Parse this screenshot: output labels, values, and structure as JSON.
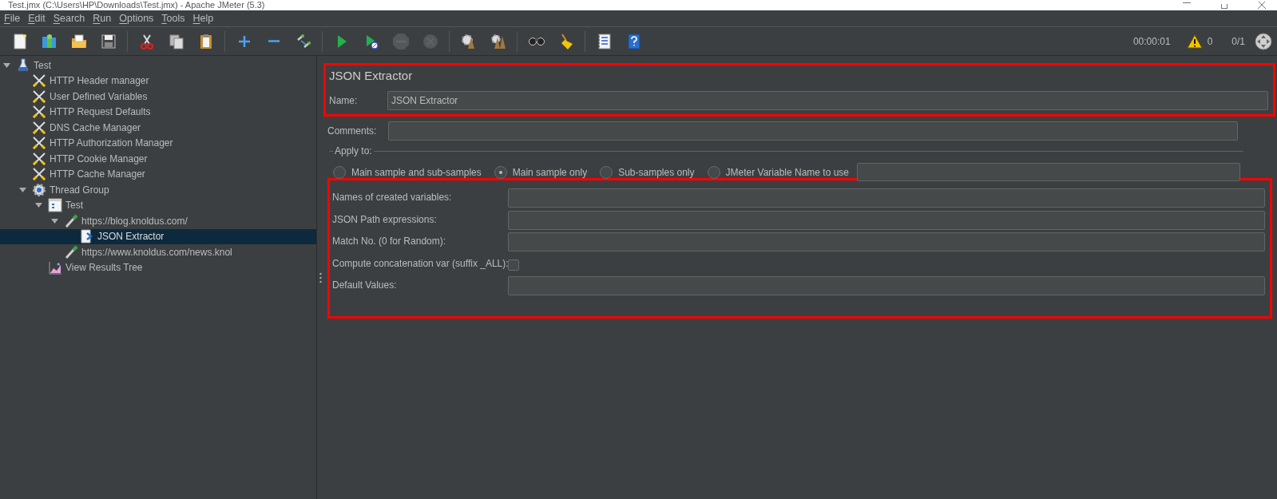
{
  "window": {
    "title": "Test.jmx (C:\\Users\\HP\\Downloads\\Test.jmx) - Apache JMeter (5.3)"
  },
  "menu": [
    "File",
    "Edit",
    "Search",
    "Run",
    "Options",
    "Tools",
    "Help"
  ],
  "toolbar": {
    "groups": [
      [
        {
          "kind": "new",
          "disabled": false
        },
        {
          "kind": "templates",
          "disabled": false
        },
        {
          "kind": "open",
          "disabled": false
        },
        {
          "kind": "save",
          "disabled": false
        }
      ],
      [
        {
          "kind": "cut",
          "disabled": false
        },
        {
          "kind": "copy",
          "disabled": false
        },
        {
          "kind": "paste",
          "disabled": false
        }
      ],
      [
        {
          "kind": "expand",
          "disabled": false
        },
        {
          "kind": "collapse",
          "disabled": false
        },
        {
          "kind": "toggle",
          "disabled": false
        }
      ],
      [
        {
          "kind": "start",
          "disabled": false
        },
        {
          "kind": "start-no-pauses",
          "disabled": false
        },
        {
          "kind": "stop",
          "disabled": true
        },
        {
          "kind": "shutdown",
          "disabled": true
        }
      ],
      [
        {
          "kind": "clear",
          "disabled": false
        },
        {
          "kind": "clear-all",
          "disabled": false
        }
      ],
      [
        {
          "kind": "search",
          "disabled": false
        },
        {
          "kind": "reset-search",
          "disabled": false
        }
      ],
      [
        {
          "kind": "functions",
          "disabled": false
        },
        {
          "kind": "help",
          "disabled": false
        }
      ]
    ],
    "timer": "00:00:01",
    "warnings": "0",
    "threads": "0/1"
  },
  "tree": [
    {
      "label": "Test",
      "kind": "test-plan",
      "expanded": true,
      "selected": false,
      "children": [
        {
          "label": "HTTP Header manager",
          "kind": "config",
          "selected": false
        },
        {
          "label": "User Defined Variables",
          "kind": "config",
          "selected": false
        },
        {
          "label": "HTTP Request Defaults",
          "kind": "config",
          "selected": false
        },
        {
          "label": "DNS Cache Manager",
          "kind": "config",
          "selected": false
        },
        {
          "label": "HTTP Authorization Manager",
          "kind": "config",
          "selected": false
        },
        {
          "label": "HTTP Cookie Manager",
          "kind": "config",
          "selected": false
        },
        {
          "label": "HTTP Cache Manager",
          "kind": "config",
          "selected": false
        },
        {
          "label": "Thread Group",
          "kind": "thread-group",
          "expanded": true,
          "selected": false,
          "children": [
            {
              "label": "Test",
              "kind": "controller",
              "expanded": true,
              "selected": false,
              "children": [
                {
                  "label": "https://blog.knoldus.com/",
                  "kind": "sampler",
                  "expanded": true,
                  "selected": false,
                  "children": [
                    {
                      "label": "JSON Extractor",
                      "kind": "extractor",
                      "selected": true
                    }
                  ]
                },
                {
                  "label": "https://www.knoldus.com/news.knol",
                  "kind": "sampler",
                  "selected": false
                }
              ]
            },
            {
              "label": "View Results Tree",
              "kind": "listener",
              "selected": false
            }
          ]
        }
      ]
    }
  ],
  "editor": {
    "title": "JSON Extractor",
    "name_label": "Name:",
    "name_value": "JSON Extractor",
    "comments_label": "Comments:",
    "apply_to": {
      "label": "Apply to:",
      "options": [
        {
          "label": "Main sample and sub-samples",
          "selected": false
        },
        {
          "label": "Main sample only",
          "selected": true
        },
        {
          "label": "Sub-samples only",
          "selected": false
        },
        {
          "label": "JMeter Variable Name to use",
          "selected": false
        }
      ]
    },
    "header_highlighted": true,
    "fields_highlighted": true,
    "fields": [
      {
        "kind": "text",
        "label": "Names of created variables:"
      },
      {
        "kind": "text",
        "label": "JSON Path expressions:"
      },
      {
        "kind": "text",
        "label": "Match No. (0 for Random):"
      },
      {
        "kind": "checkbox",
        "label": "Compute concatenation var (suffix _ALL):",
        "checked": false
      },
      {
        "kind": "text",
        "label": "Default Values:"
      }
    ]
  }
}
